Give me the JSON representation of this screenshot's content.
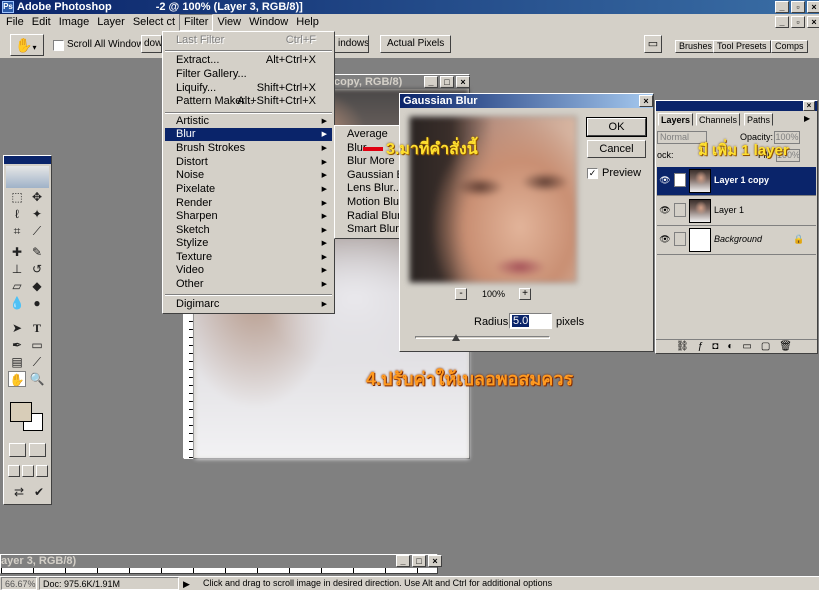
{
  "window": {
    "title": "Adobe Photoshop",
    "doc_title_fragment": "-2 @ 100% (Layer 3, RGB/8)]"
  },
  "menubar": {
    "items": [
      "File",
      "Edit",
      "Image",
      "Layer",
      "Select",
      "Filter",
      "View",
      "Window",
      "Help"
    ],
    "select_trunc": "Select  ",
    "select_tail": "ct",
    "active": "Filter"
  },
  "options": {
    "scroll_all": "Scroll All Windows",
    "frag_left": "dow",
    "frag_right": "indows",
    "actual_pixels": "Actual Pixels",
    "tabs": [
      "Brushes",
      "Tool Presets",
      "Comps"
    ]
  },
  "filter_menu": {
    "last_filter": {
      "label": "Last Filter",
      "shortcut": "Ctrl+F"
    },
    "extract": {
      "label": "Extract...",
      "shortcut": "Alt+Ctrl+X"
    },
    "gallery": {
      "label": "Filter Gallery..."
    },
    "liquify": {
      "label": "Liquify...",
      "shortcut": "Shift+Ctrl+X"
    },
    "pattern": {
      "label": "Pattern Maker...",
      "shortcut": "Alt+Shift+Ctrl+X"
    },
    "submenus": [
      "Artistic",
      "Blur",
      "Brush Strokes",
      "Distort",
      "Noise",
      "Pixelate",
      "Render",
      "Sharpen",
      "Sketch",
      "Stylize",
      "Texture",
      "Video",
      "Other"
    ],
    "digimarc": "Digimarc"
  },
  "blur_menu": {
    "items": [
      "Average",
      "Blur",
      "Blur More",
      "Gaussian Blur...",
      "Lens Blur...",
      "Motion Blur...",
      "Radial Blur...",
      "Smart Blur..."
    ]
  },
  "doc_window": {
    "title": "copy, RGB/8)"
  },
  "gaussian": {
    "title": "Gaussian Blur",
    "ok": "OK",
    "cancel": "Cancel",
    "preview": "Preview",
    "zoom": "100%",
    "minus": "-",
    "plus": "+",
    "radius_label": "Radius:",
    "radius_value": "5.0",
    "unit": "pixels",
    "slider_level": 0.3
  },
  "layers": {
    "tabs": [
      "Layers",
      "Channels",
      "Paths"
    ],
    "blend": "Normal",
    "opacity_label": "Opacity:",
    "opacity": "100%",
    "lock_label": "ock:",
    "fill_label": "Fill:",
    "fill": "100%",
    "rows": [
      {
        "name": "Layer 1 copy",
        "selected": true
      },
      {
        "name": "Layer 1",
        "selected": false
      },
      {
        "name": "Background",
        "selected": false
      }
    ]
  },
  "doc2": {
    "title": "ayer 3, RGB/8)"
  },
  "status": {
    "zoom": "66.67%",
    "doc": "Doc: 975.6K/1.91M",
    "hint": "Click and drag to scroll image in desired direction.  Use Alt and Ctrl for additional options"
  },
  "annotations": {
    "step3": "3.มาที่คำสั่งนี้",
    "step4": "4.ปรับค่าให้เบลอพอสมควร",
    "add_layer": "มี เพิ่ม 1 layer"
  },
  "colors": {
    "titlebar": "#0a246a",
    "menu_highlight": "#0a246a",
    "annot_yellow": "#ffe030",
    "annot_orange": "#ff9a20",
    "annot_red": "#e00010"
  }
}
